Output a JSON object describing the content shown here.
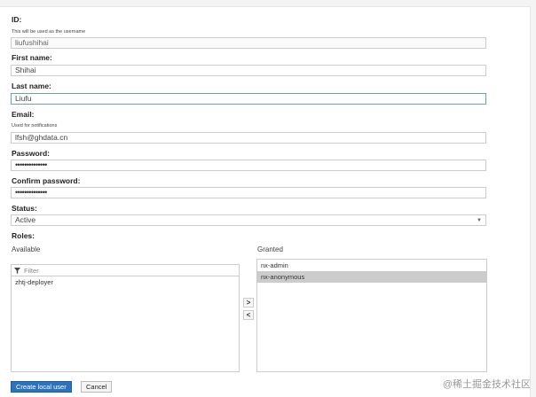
{
  "labels": {
    "id": "ID:",
    "first_name": "First name:",
    "last_name": "Last name:",
    "email": "Email:",
    "password": "Password:",
    "confirm_password": "Confirm password:",
    "status": "Status:",
    "roles": "Roles:"
  },
  "help": {
    "id": "This will be used as the username",
    "email": "Used for notifications"
  },
  "values": {
    "id": "liufushihai",
    "first_name": "Shihai",
    "last_name": "Liufu",
    "email": "lfsh@ghdata.cn",
    "password": "••••••••••••••",
    "confirm_password": "••••••••••••••",
    "status": "Active"
  },
  "roles": {
    "available_label": "Available",
    "granted_label": "Granted",
    "filter_placeholder": "Filter",
    "available": [
      "zhtj-deployer"
    ],
    "granted": [
      {
        "name": "nx-admin",
        "selected": false
      },
      {
        "name": "nx-anonymous",
        "selected": true
      }
    ],
    "move_right": ">",
    "move_left": "<"
  },
  "buttons": {
    "create": "Create local user",
    "cancel": "Cancel"
  },
  "watermark": "@稀土掘金技术社区",
  "colors": {
    "primary": "#2a74bd",
    "focus_border": "#6a9bd8",
    "selected_row": "#cccccc"
  },
  "icons": {
    "filter": "filter-funnel-icon",
    "status_dropdown": "chevron-down-icon"
  }
}
